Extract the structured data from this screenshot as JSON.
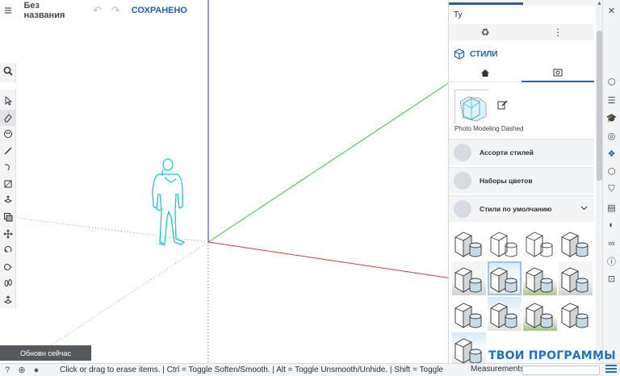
{
  "app": {
    "document_title": "Без названия",
    "save_status": "СОХРАНЕНО"
  },
  "left_toolbar": {
    "search": "search",
    "tools": [
      "select",
      "eraser",
      "paint",
      "line",
      "arc",
      "rectangle",
      "push-pull",
      "offset",
      "move",
      "rotate",
      "tape",
      "walk",
      "section"
    ]
  },
  "panel": {
    "prev_section_label": "Ту",
    "styles_title": "СТИЛИ",
    "current_style_name": "Photo Modeling Dashed",
    "rows": [
      {
        "label": "Ассорти стилей"
      },
      {
        "label": "Наборы цветов"
      },
      {
        "label": "Стили по умолчанию"
      }
    ]
  },
  "status": {
    "updated_badge": "Обновн сейчас",
    "hint": "Click or drag to erase items. | Ctrl = Toggle Soften/Smooth. | Alt = Toggle Unsmooth/Unhide. | Shift = Toggle",
    "measurements_label": "Measurements"
  },
  "watermark": "ТВОИ ПРОГРАММЫ РУ",
  "colors": {
    "accent": "#1f60b0",
    "axis_blue": "#2b2bd6",
    "axis_green": "#3fbf3f",
    "axis_red": "#d23c3c",
    "person": "#17c7d8"
  }
}
